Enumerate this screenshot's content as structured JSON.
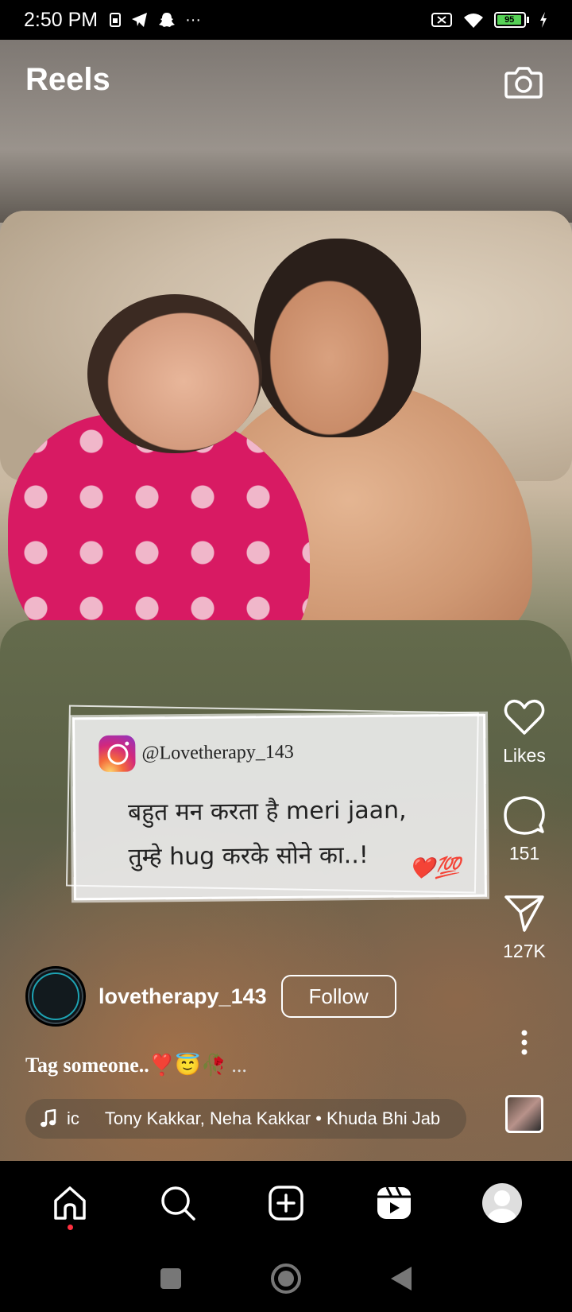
{
  "status_bar": {
    "time": "2:50 PM",
    "left_icons": [
      "sim-icon",
      "telegram-icon",
      "snapchat-icon",
      "more-icon"
    ],
    "right_icons": [
      "no-sim-icon",
      "wifi-icon",
      "battery-icon",
      "charging-icon"
    ],
    "battery": "95",
    "more": "···"
  },
  "header": {
    "title": "Reels",
    "camera_icon": "camera-icon"
  },
  "quote_card": {
    "handle": "@Lovetherapy_143",
    "text": "बहुत मन करता है meri jaan,\nतुम्हे hug करके सोने का..!",
    "emoji": "❤️💯"
  },
  "actions": {
    "likes_label": "Likes",
    "comments_count": "151",
    "shares_count": "127K"
  },
  "author": {
    "username": "lovetherapy_143",
    "follow_label": "Follow"
  },
  "caption": {
    "text": "Tag someone..❣️😇🥀",
    "more": "..."
  },
  "music": {
    "short": "ic",
    "track": "Tony Kakkar, Neha Kakkar • Khuda Bhi Jab"
  },
  "bottom_nav": [
    "home-icon",
    "search-icon",
    "create-icon",
    "reels-icon",
    "profile-avatar"
  ],
  "colors": {
    "accent_dot": "#ff3040",
    "battery_green": "#56d156",
    "follow_border": "#ffffff"
  }
}
